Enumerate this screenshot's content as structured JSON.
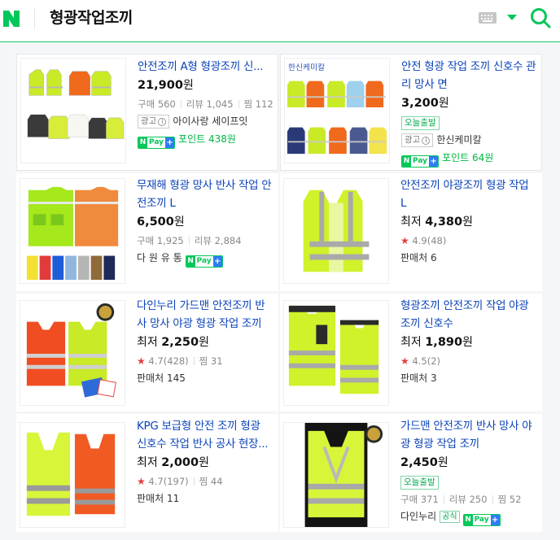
{
  "header": {
    "query": "형광작업조끼",
    "logo": "N"
  },
  "products": [
    {
      "title": "안전조끼 A형 형광조끼 신...",
      "price": "21,900",
      "won": "원",
      "purchase_label": "구매",
      "purchases": "560",
      "review_label": "리뷰",
      "reviews": "1,045",
      "zzim_label": "찜",
      "zzim": "112",
      "ad_label": "광고",
      "seller": "아이사랑 세이프잇",
      "point_text": "포인트 438원"
    },
    {
      "title": "안전 형광 작업 조끼 신호수 관리 망사 면",
      "price": "3,200",
      "won": "원",
      "delivery_tag": "오늘출발",
      "ad_label": "광고",
      "seller": "한신케미칼",
      "point_text": "포인트 64원",
      "thumb_brand": "한신케미칼"
    },
    {
      "title": "무재해 형광 망사 반사 작업 안전조끼 L",
      "price": "6,500",
      "won": "원",
      "purchase_label": "구매",
      "purchases": "1,925",
      "review_label": "리뷰",
      "reviews": "2,884",
      "seller": "다 원 유 통"
    },
    {
      "title": "안전조끼 야광조끼 형광 작업 L",
      "price_prefix": "최저",
      "price": "4,380",
      "won": "원",
      "rating": "4.9",
      "rating_count": "(48)",
      "sellers_label": "판매처",
      "sellers": "6"
    },
    {
      "title": "다인누리 가드맨 안전조끼 반사 망사 야광 형광 작업 조끼",
      "price_prefix": "최저",
      "price": "2,250",
      "won": "원",
      "rating": "4.7",
      "rating_count": "(428)",
      "zzim_label": "찜",
      "zzim": "31",
      "sellers_label": "판매처",
      "sellers": "145"
    },
    {
      "title": "형광조끼 안전조끼 작업 야광 조끼 신호수",
      "price_prefix": "최저",
      "price": "1,890",
      "won": "원",
      "rating": "4.5",
      "rating_count": "(2)",
      "sellers_label": "판매처",
      "sellers": "3"
    },
    {
      "title": "KPG 보급형 안전 조끼 형광 신호수 작업 반사 공사 현장...",
      "price_prefix": "최저",
      "price": "2,000",
      "won": "원",
      "rating": "4.7",
      "rating_count": "(197)",
      "zzim_label": "찜",
      "zzim": "44",
      "sellers_label": "판매처",
      "sellers": "11"
    },
    {
      "title": "가드맨 안전조끼 반사 망사 야광 형광 작업 조끼",
      "price": "2,450",
      "won": "원",
      "delivery_tag": "오늘출발",
      "purchase_label": "구매",
      "purchases": "371",
      "review_label": "리뷰",
      "reviews": "250",
      "zzim_label": "찜",
      "zzim": "52",
      "seller": "다인누리",
      "official_label": "공식"
    }
  ],
  "npay": {
    "n": "N",
    "pay": "Pay",
    "plus": "+"
  },
  "colors": {
    "accent": "#03c75a",
    "title_link": "#0b43b8",
    "star": "#e83c3c",
    "point": "#00b843"
  },
  "icons": [
    "naver-logo-icon",
    "keyboard-icon",
    "chevron-down-icon",
    "search-icon",
    "star-icon",
    "info-icon",
    "npay-icon"
  ]
}
